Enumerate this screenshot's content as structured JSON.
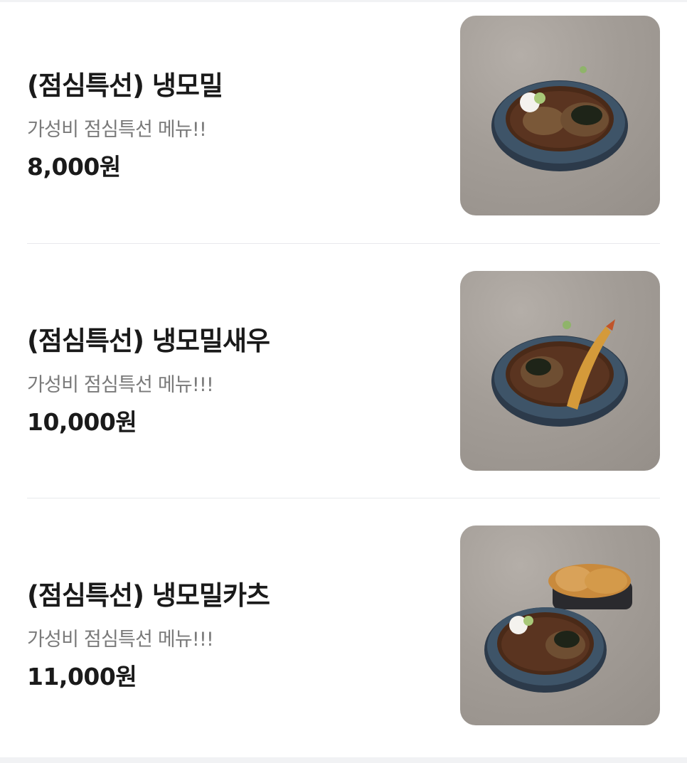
{
  "menu": {
    "items": [
      {
        "name": "(점심특선) 냉모밀",
        "description": "가성비 점심특선 메뉴!!",
        "price": "8,000원",
        "image_icon": "cold-soba-bowl-image"
      },
      {
        "name": "(점심특선) 냉모밀새우",
        "description": "가성비 점심특선 메뉴!!!",
        "price": "10,000원",
        "image_icon": "cold-soba-shrimp-tempura-image"
      },
      {
        "name": "(점심특선) 냉모밀카츠",
        "description": "가성비 점심특선 메뉴!!!",
        "price": "11,000원",
        "image_icon": "cold-soba-katsu-image"
      }
    ]
  },
  "colors": {
    "title": "#1a1a1a",
    "description": "#7a7a7a",
    "divider": "#e8e9ec",
    "background": "#ffffff"
  }
}
